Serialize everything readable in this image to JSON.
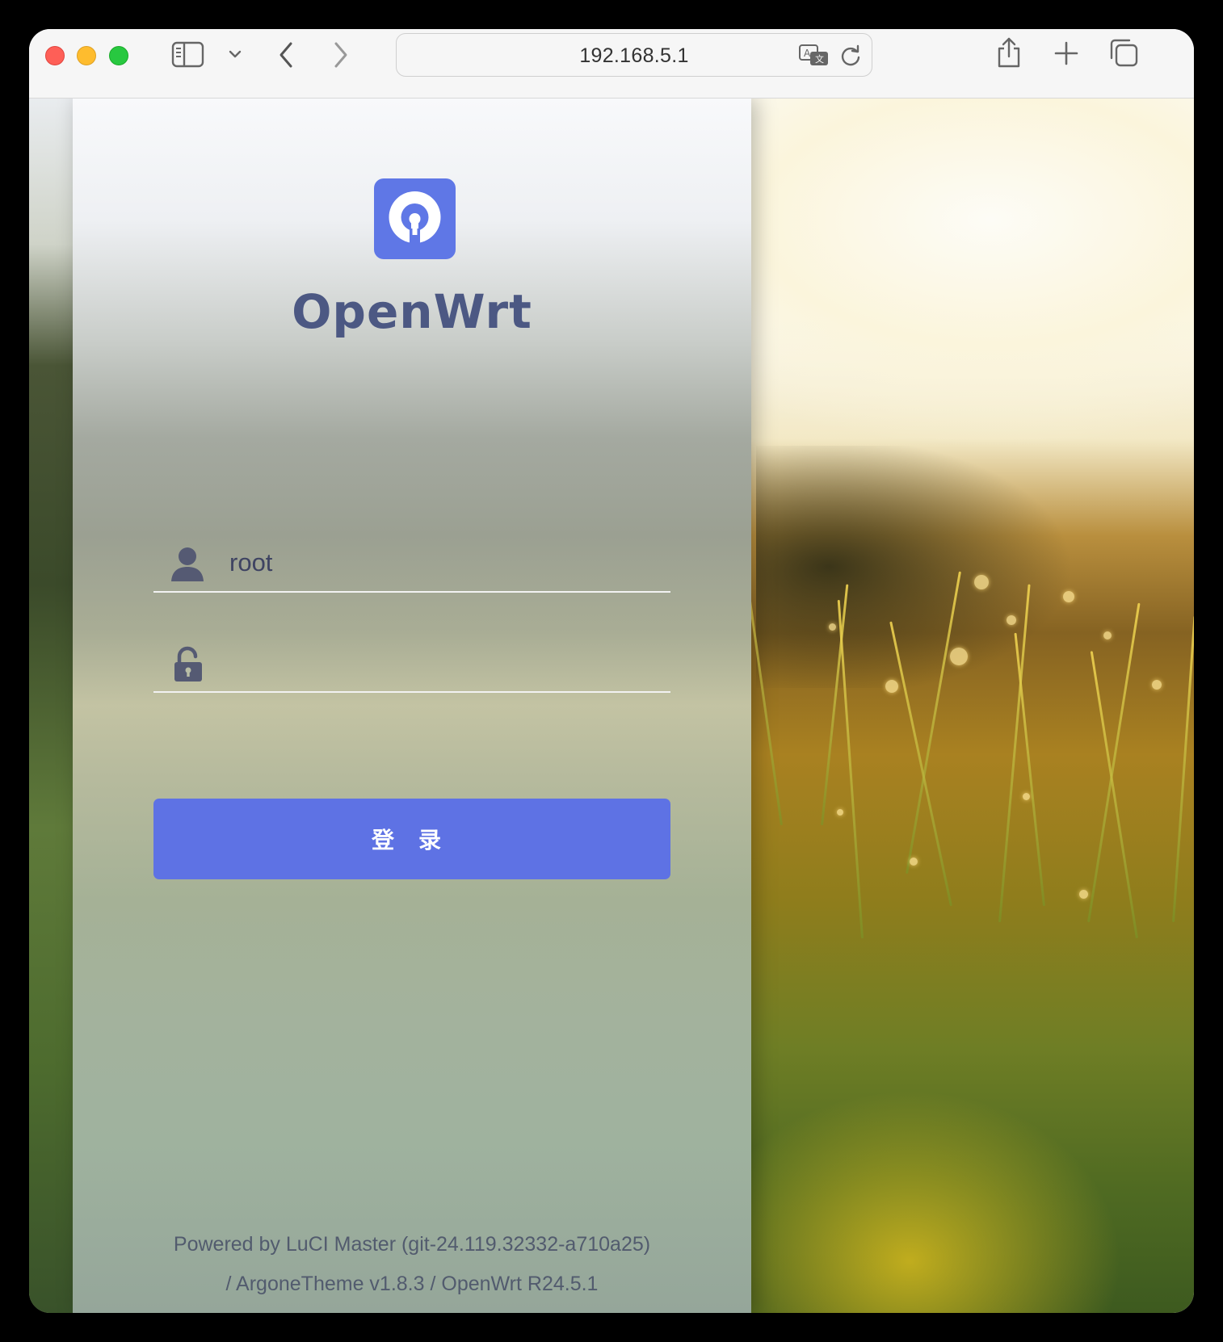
{
  "browser": {
    "address": "192.168.5.1",
    "icons": {
      "sidebar": "sidebar-icon",
      "chevron": "chevron-down-icon",
      "back": "back-icon",
      "forward": "forward-icon",
      "translate": "translate-icon",
      "reload": "reload-icon",
      "share": "share-icon",
      "new_tab": "plus-icon",
      "tabs": "tab-overview-icon"
    }
  },
  "login": {
    "brand": "OpenWrt",
    "username_value": "root",
    "password_value": "",
    "submit_label": "登录",
    "accent_color": "#5e72e4",
    "brand_color": "#4c5883"
  },
  "footer": {
    "line1": "Powered by LuCI Master (git-24.119.32332-a710a25)",
    "line2": "/ ArgoneTheme v1.8.3 / OpenWrt R24.5.1"
  }
}
